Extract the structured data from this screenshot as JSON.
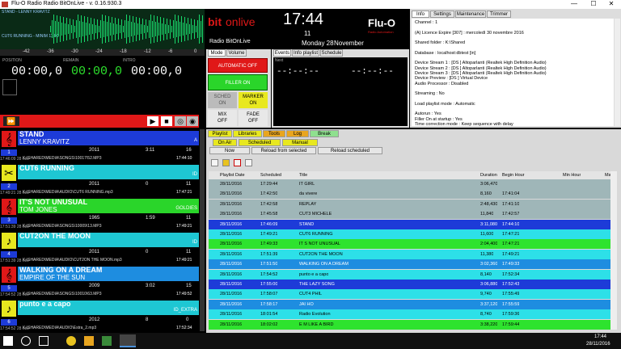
{
  "window": {
    "title": "Flu-O Radio Radio BitOnLive - v. 0.16.930.3",
    "minimize": "—",
    "maximize": "☐",
    "close": "✕"
  },
  "top": {
    "stand_label": "STAND - LENNY KRAVITZ",
    "cut_label": "CUT6 RUNNING - MINIM 11 00",
    "scale": [
      "-42",
      "-36",
      "-30",
      "-24",
      "-18",
      "-12",
      "-6",
      "0"
    ],
    "pos_label": "POSITION",
    "remain_label": "REMAIN",
    "intro_label": "INTRO",
    "pos_val": "00:00,0",
    "remain_val": "00:00,0",
    "intro_val": "00:00,0"
  },
  "logo": {
    "brand1": "bit",
    "brand2": "onlive",
    "station": "Radio BitOnLive",
    "flu": "Flu-O",
    "flu_sub": "Radio Automation"
  },
  "clock": {
    "time": "17:44",
    "num": "11",
    "day": "Monday 28",
    "month": "November"
  },
  "left_tabs": {
    "mode": "Mode",
    "volume": "Volume"
  },
  "mode_buttons": {
    "automatic": "AUTOMATIC OFF",
    "filler": "FILLER ON",
    "schedule": "SCHED\nON",
    "marker": "MARKER\nON",
    "mix": "MIX\nOFF",
    "fade": "FADE\nOFF"
  },
  "event_tabs": {
    "events": "Events",
    "info": "Info playlist",
    "schedule": "Schedule"
  },
  "next": {
    "label": "Next",
    "t1": "--:--:--",
    "t2": "--:--:--"
  },
  "info_tabs": [
    "Info",
    "Settings",
    "Maintenance",
    "Trimmer"
  ],
  "info_lines": [
    "Channel : 1",
    "",
    "(A) Licence Expire [307] : mercoledì 30 novembre 2016",
    "",
    "Shared folder : K:\\Shared",
    "",
    "Database : localhost:dbtest [in]",
    "",
    "Device Stream 1 : [DS ] Altoparlanti (Realtek High Definition Audio)",
    "Device Stream 2 : [DS ] Altoparlanti (Realtek High Definition Audio)",
    "Device Stream 3 : [DS ] Altoparlanti (Realtek High Definition Audio)",
    "Device Preview : [DS ] Virtual Device",
    "Audio Processor : Disabled",
    "",
    "Streaming : No",
    "",
    "Load playlist mode : Automatic",
    "",
    "Autorun : Yes",
    "Filler On at startup : Yes",
    "Time correction mode : Keep sequence with delay"
  ],
  "player": {
    "play": "▶",
    "stop": "■",
    "loop": "◎",
    "mute": "◉",
    "skip": "⏩"
  },
  "items": [
    {
      "title": "STAND",
      "artist": "LENNY KRAVITZ",
      "code": "A",
      "num": "1",
      "year": "2011",
      "dur": "3:11",
      "n2": "16",
      "date": "17:46:09  28 nov",
      "path": "K:\\SHARED\\MEDIA\\SONGS\\10017\\52.MP3",
      "end": "17:44:10",
      "c1": "#1d3bd8",
      "c2": "#1d3bd8",
      "icon": "𝄞"
    },
    {
      "title": "CUT6 RUNNING",
      "artist": "",
      "code": "ID",
      "num": "2",
      "year": "2011",
      "dur": "0",
      "n2": "11",
      "date": "17:49:21  28 nov",
      "path": "K:\\SHARED\\MEDIA\\AUDIO\\CUT6 RUNNING.mp3",
      "end": "17:47:21",
      "c1": "#1ec7d3",
      "c2": "#1ec7d3",
      "icon": "✂"
    },
    {
      "title": "IT'S NOT UNUSUAL",
      "artist": "TOM JONES",
      "code": "GOLDIES",
      "num": "3",
      "year": "1965",
      "dur": "1:59",
      "n2": "11",
      "date": "17:51:39  28 nov",
      "path": "K:\\SHARED\\MEDIA\\SONGS\\10009\\13.MP3",
      "end": "17:49:21",
      "c1": "#2ad52a",
      "c2": "#2ad52a",
      "icon": "𝄞"
    },
    {
      "title": "CUT2ON THE MOON",
      "artist": "",
      "code": "ID",
      "num": "4",
      "year": "2011",
      "dur": "0",
      "n2": "11",
      "date": "17:51:39  28 nov",
      "path": "K:\\SHARED\\MEDIA\\AUDIO\\CUT2ON THE MOON.mp3",
      "end": "17:49:21",
      "c1": "#1ec7d3",
      "c2": "#1ec7d3",
      "icon": "♪"
    },
    {
      "title": "WALKING ON A DREAM",
      "artist": "EMPIRE OF THE SUN",
      "code": "",
      "num": "5",
      "year": "2009",
      "dur": "3:02",
      "n2": "15",
      "date": "17:54:52  28 nov",
      "path": "K:\\SHARED\\MEDIA\\SONGS\\10010\\63.MP3",
      "end": "17:49:52",
      "c1": "#1e8de0",
      "c2": "#1e8de0",
      "icon": "𝄞"
    },
    {
      "title": "punto e a capo",
      "artist": "",
      "code": "ID_EXTRA",
      "num": "6",
      "year": "2012",
      "dur": "8",
      "n2": "0",
      "date": "17:54:52  28 nov",
      "path": "K:\\SHARED\\MEDIA\\AUDIO\\Estra_2.mp3",
      "end": "17:52:34",
      "c1": "#1ec7d3",
      "c2": "#1ec7d3",
      "icon": "♪"
    }
  ],
  "main_tabs": [
    "Playlist",
    "Libraries",
    "Tools",
    "Log",
    "Break"
  ],
  "sub_tabs": [
    "On Air",
    "Scheduled",
    "Manual"
  ],
  "actions": {
    "now": "Now",
    "reload_sel": "Reload from selected",
    "reload_sch": "Reload scheduled"
  },
  "columns": [
    "Playlist Date",
    "Scheduled",
    "Title",
    "Duration",
    "Begin Hour",
    "Min Hour",
    "Ma"
  ],
  "rows": [
    {
      "date": "28/11/2016",
      "sched": "17:29:44",
      "title": "IT GIRL",
      "dur": "3:06,470",
      "begin": "",
      "bg": "#9fb6b8"
    },
    {
      "date": "28/11/2016",
      "sched": "17:42:50",
      "title": "da vivere",
      "dur": "8,160",
      "begin": "17:41:04",
      "bg": "#9fb6b8"
    },
    {
      "date": "28/11/2016",
      "sched": "17:42:58",
      "title": "REPLAY",
      "dur": "2:48,430",
      "begin": "17:41:10",
      "bg": "#9fb6b8"
    },
    {
      "date": "28/11/2016",
      "sched": "17:45:58",
      "title": "CUT3 MICHELE",
      "dur": "11,840",
      "begin": "17:42:57",
      "bg": "#9fb6b8"
    },
    {
      "date": "28/11/2016",
      "sched": "17:46:09",
      "title": "STAND",
      "dur": "3:11,080",
      "begin": "17:44:10",
      "bg": "#1d3bd8"
    },
    {
      "date": "28/11/2016",
      "sched": "17:49:21",
      "title": "CUT6 RUNNING",
      "dur": "11,600",
      "begin": "17:47:21",
      "bg": "#2de0e8"
    },
    {
      "date": "28/11/2016",
      "sched": "17:49:33",
      "title": "IT S NOT UNUSUAL",
      "dur": "2:04,400",
      "begin": "17:47:21",
      "bg": "#2ee32e"
    },
    {
      "date": "28/11/2016",
      "sched": "17:51:39",
      "title": "CUT2ON THE MOON",
      "dur": "11,380",
      "begin": "17:49:21",
      "bg": "#2de0e8"
    },
    {
      "date": "28/11/2016",
      "sched": "17:51:50",
      "title": "WALKING ON A DREAM",
      "dur": "3:02,360",
      "begin": "17:49:33",
      "bg": "#1e8de0"
    },
    {
      "date": "28/11/2016",
      "sched": "17:54:52",
      "title": "punto e a capo",
      "dur": "8,140",
      "begin": "17:52:34",
      "bg": "#2de0e8"
    },
    {
      "date": "28/11/2016",
      "sched": "17:55:00",
      "title": "THE LAZY SONG",
      "dur": "3:06,880",
      "begin": "17:52:43",
      "bg": "#1d3bd8"
    },
    {
      "date": "28/11/2016",
      "sched": "17:58:07",
      "title": "CUT4 PHIL",
      "dur": "9,740",
      "begin": "17:55:49",
      "bg": "#2de0e8"
    },
    {
      "date": "28/11/2016",
      "sched": "17:58:17",
      "title": "JAI HO",
      "dur": "3:37,120",
      "begin": "17:55:59",
      "bg": "#1e8de0"
    },
    {
      "date": "28/11/2016",
      "sched": "18:01:54",
      "title": "Radio Evolution",
      "dur": "8,740",
      "begin": "17:59:36",
      "bg": "#2de0e8"
    },
    {
      "date": "28/11/2016",
      "sched": "18:02:02",
      "title": "E M LIKE A BIRD",
      "dur": "3:38,220",
      "begin": "17:59:44",
      "bg": "#2ee32e"
    }
  ],
  "taskbar": {
    "time": "17:44",
    "date": "28/11/2016"
  }
}
